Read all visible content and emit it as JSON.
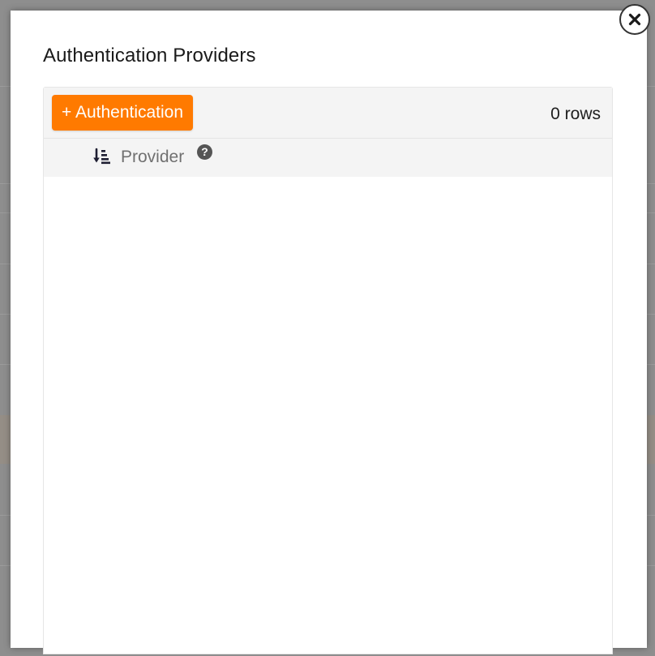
{
  "modal": {
    "title": "Authentication Providers",
    "close_icon": "close-icon"
  },
  "toolbar": {
    "add_label": "+ Authentication",
    "row_count": "0 rows",
    "accent_color": "#ff7a00"
  },
  "table": {
    "columns": [
      {
        "label": "Provider",
        "sort_icon": "sort-ascending-icon",
        "help_icon": "question-circle-icon",
        "help_glyph": "?"
      }
    ],
    "rows": []
  }
}
